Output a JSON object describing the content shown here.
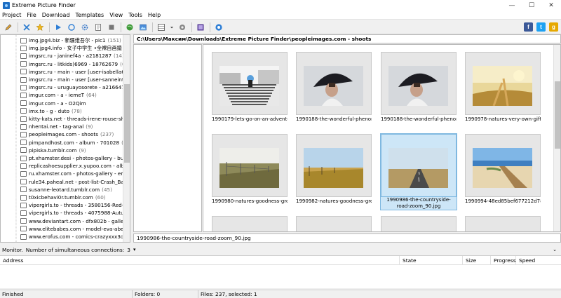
{
  "window": {
    "title": "Extreme Picture Finder"
  },
  "menu": [
    "Project",
    "File",
    "Download",
    "Templates",
    "View",
    "Tools",
    "Help"
  ],
  "path": "C:\\Users\\Максим\\Downloads\\Extreme Picture Finder\\peopleimages.com - shoots",
  "tree": [
    {
      "label": "img.jpg4.biz - 新疆维吾尔 - pic1",
      "count": "(151)"
    },
    {
      "label": "img.jpg4.info - 女子中学生 •全裸自画撮り - p",
      "count": ""
    },
    {
      "label": "imgsrc.ru - janinef4a - a2181287",
      "count": "(14)"
    },
    {
      "label": "imgsrc.ru - litkids)6969 - 18762679",
      "count": "(0)"
    },
    {
      "label": "imgsrc.ru - main - user [user-isabella666]",
      "count": "(0)"
    },
    {
      "label": "imgsrc.ru - main - user [user-sanneintveld]",
      "count": "(0)"
    },
    {
      "label": "imgsrc.ru - uruguayosorete - a2166471",
      "count": "(29)"
    },
    {
      "label": "imgur.com - a - iemeT",
      "count": "(64)"
    },
    {
      "label": "imgur.com - a - O2Qim",
      "count": ""
    },
    {
      "label": "imx.to - g - duto",
      "count": "(78)"
    },
    {
      "label": "kitty-kats.net - threads-irene-rouse-shamelessly",
      "count": ""
    },
    {
      "label": "nhentai.net - tag-anal",
      "count": "(9)"
    },
    {
      "label": "peopleimages.com - shoots",
      "count": "(237)"
    },
    {
      "label": "pimpandhost.com - album - 701028",
      "count": "(57)"
    },
    {
      "label": "pipiska.tumblr.com",
      "count": "(9)"
    },
    {
      "label": "pt.xhamster.desi - photos-gallery - busty-emory-",
      "count": ""
    },
    {
      "label": "replicashoesupplier.x.yupoo.com - albums - 72",
      "count": ""
    },
    {
      "label": "ru.xhamster.com - photos-gallery - emelia-paige",
      "count": ""
    },
    {
      "label": "rule34.paheal.net - post-list-Crash_Bandicoot_",
      "count": ""
    },
    {
      "label": "susanne-leotard.tumblr.com",
      "count": "(45)"
    },
    {
      "label": "t0xicbehavi0r.tumblr.com",
      "count": "(60)"
    },
    {
      "label": "vipergirls.to - threads - 3580156-Red-Fox-Loka",
      "count": ""
    },
    {
      "label": "vipergirls.to - threads - 4075988-Autumn-Falls-M",
      "count": ""
    },
    {
      "label": "www.deviantart.com - dfx802b - gallery",
      "count": "(9)"
    },
    {
      "label": "www.elitebabes.com - model-eva-abel",
      "count": "(41)"
    },
    {
      "label": "www.erofus.com - comics-crazyxxx3dworld-co",
      "count": ""
    }
  ],
  "thumbnails": [
    {
      "caption": "1990179-lets-go-on-an-adventure-zo...",
      "scene": "stairs"
    },
    {
      "caption": "1990188-the-wonderful-phenomenon-...",
      "scene": "umbrella"
    },
    {
      "caption": "1990188-the-wonderful-phenomenon-...",
      "scene": "umbrella"
    },
    {
      "caption": "1990978-natures-very-own-gift-to-hu...",
      "scene": "wheat"
    },
    {
      "caption": "1990980-natures-goodness-grows-her...",
      "scene": "field"
    },
    {
      "caption": "1990982-natures-goodness-grows-her...",
      "scene": "field2"
    },
    {
      "caption": "1990986-the-countryside-road-zoom_90.jpg",
      "scene": "road",
      "selected": true
    },
    {
      "caption": "1990994-48ed85bef677212d787332...",
      "scene": "boardwalk"
    }
  ],
  "selected_file": "1990986-the-countryside-road-zoom_90.jpg",
  "monitor": {
    "label": "Monitor.",
    "connections_label": "Number of simultaneous connections:",
    "connections_value": "3"
  },
  "download_columns": [
    "Address",
    "State",
    "Size",
    "Progress",
    "Speed"
  ],
  "status": {
    "state": "Finished",
    "folders": "Folders: 0",
    "files": "Files: 237, selected: 1"
  },
  "social": [
    "f",
    "t",
    "g"
  ]
}
